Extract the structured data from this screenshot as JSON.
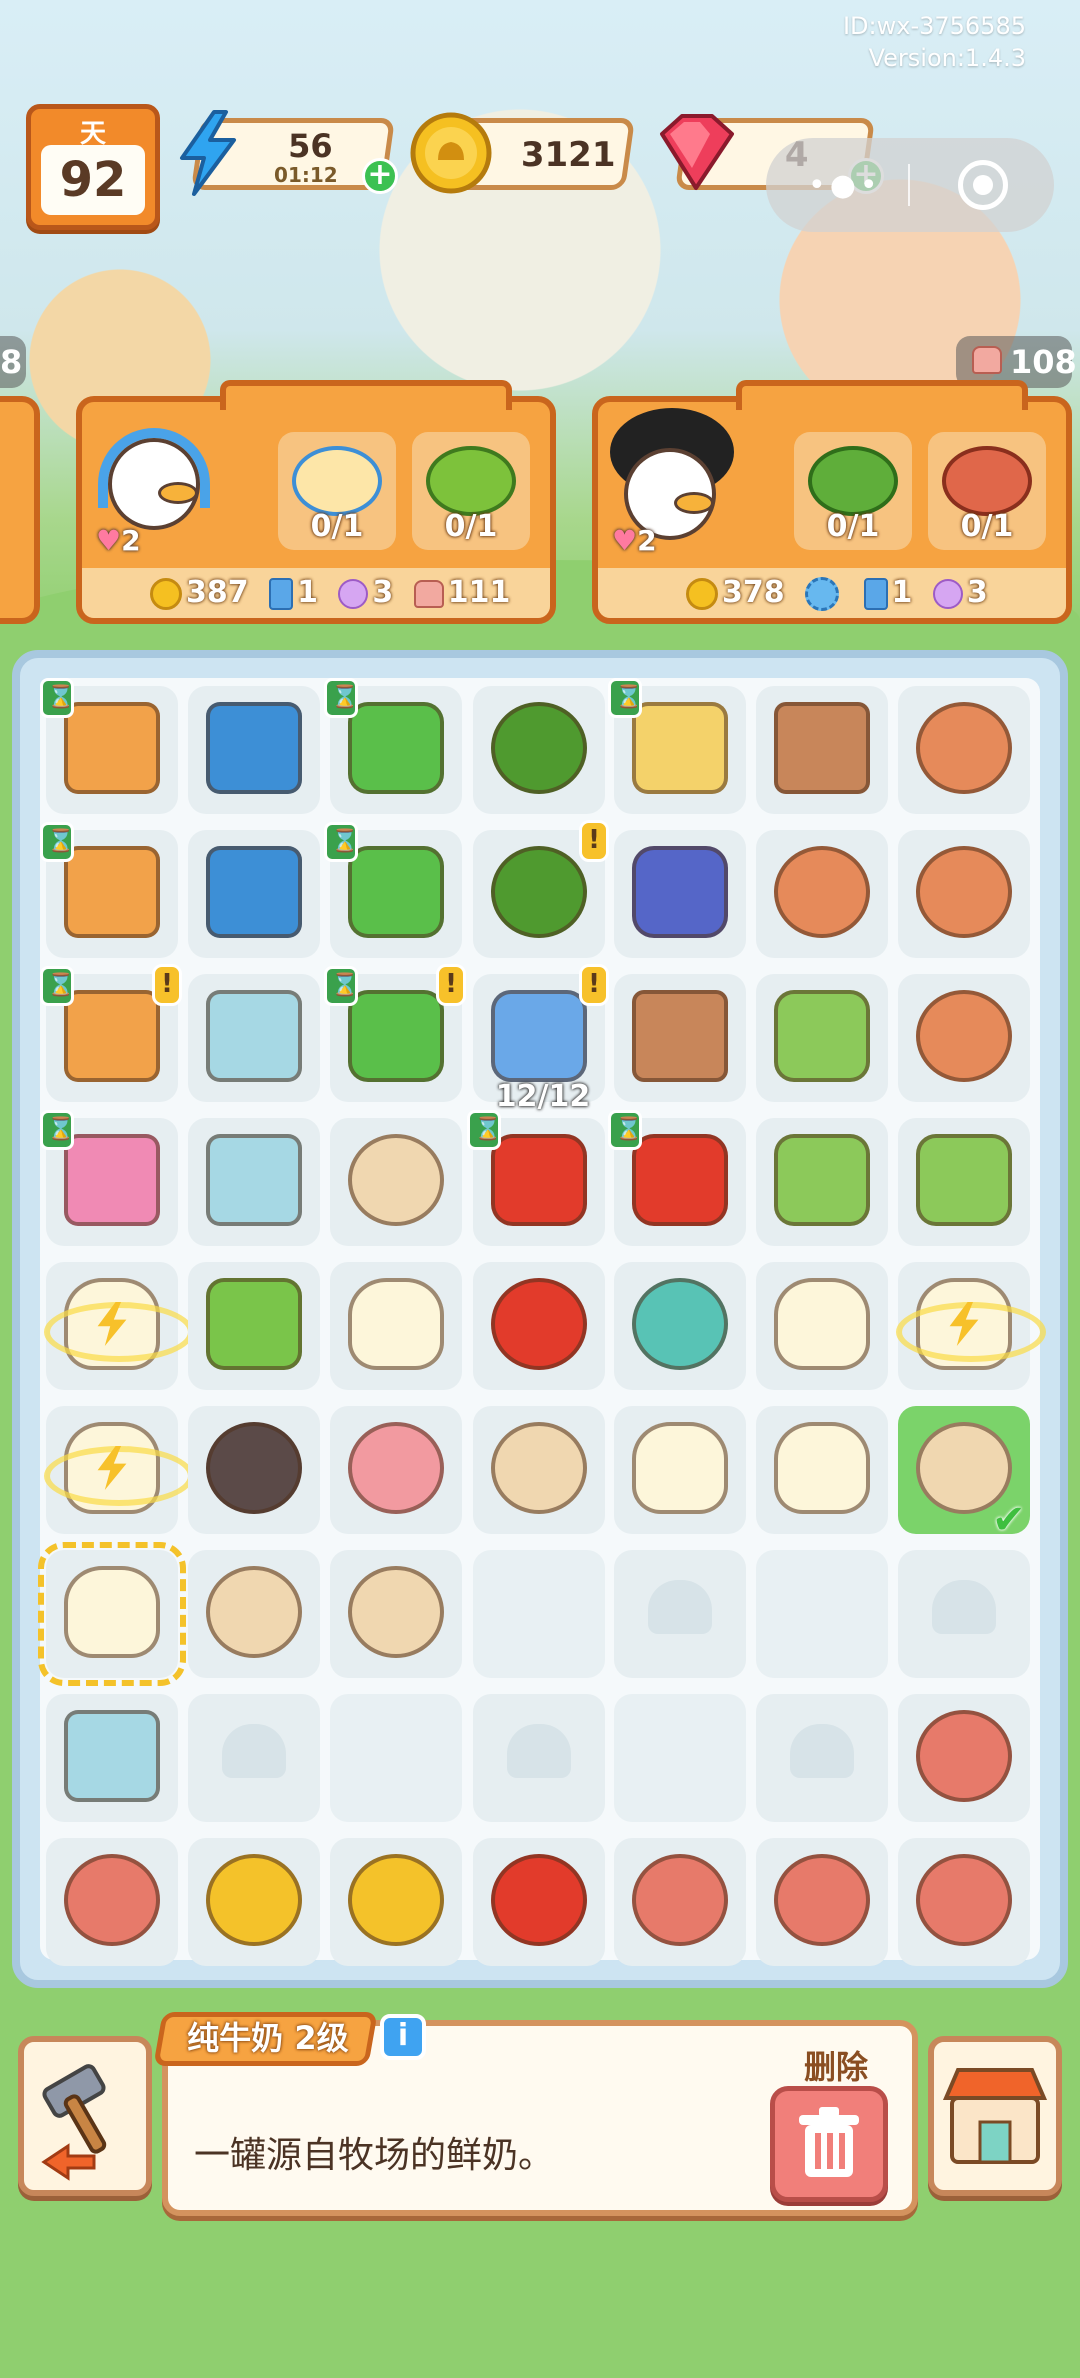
{
  "meta": {
    "id": "ID:wx-3756585",
    "version": "Version:1.4.3"
  },
  "hud": {
    "day_label": "天",
    "day_value": "92",
    "energy": {
      "value": "56",
      "timer": "01:12"
    },
    "coins": {
      "value": "3121"
    },
    "gems": {
      "value": "4"
    }
  },
  "side_badges": {
    "left": "8",
    "right": "108"
  },
  "orders": [
    {
      "customer": "duck-headphones",
      "hearts": "2",
      "items": [
        {
          "name": "porridge",
          "count": "0/1"
        },
        {
          "name": "broccoli",
          "count": "0/1"
        }
      ],
      "rewards": {
        "coins": "387",
        "cards": "1",
        "flowers": "3",
        "cakes": "111"
      }
    },
    {
      "customer": "duck-afro",
      "hearts": "2",
      "items": [
        {
          "name": "greens",
          "count": "0/1"
        },
        {
          "name": "braised-fish",
          "count": "0/1"
        }
      ],
      "rewards": {
        "coins": "378",
        "cards": "1",
        "flowers": "3"
      }
    }
  ],
  "board": {
    "fridge_capacity": "12/12",
    "cells": [
      [
        "cutting-station",
        "blue-oven",
        "green-stove",
        "fruit-bowl",
        "juicer",
        "spice-rack",
        "fishing-basket"
      ],
      [
        "knife-station",
        "blue-oven-2",
        "green-stove-2",
        "fruit-bowl-2",
        "bbq-grill",
        "veggie-basket",
        "fishing-rod"
      ],
      [
        "cheese-board",
        "ice-box",
        "green-stove-3",
        "fridge",
        "veggie-crate",
        "herb-box",
        "fish-lure"
      ],
      [
        "microwave",
        "glass-box",
        "teacup",
        "pot",
        "grill-pan",
        "leeks",
        "spice-jar"
      ],
      [
        "milk-bottle-glow",
        "soda-can",
        "milk-bottle",
        "tomato",
        "crab",
        "milk-bottle",
        "milk-bottle-glow"
      ],
      [
        "milk-bottle-glow",
        "eel",
        "squid",
        "coffee-cup",
        "milk-bottle",
        "milk-bottle",
        "red-tea-cup"
      ],
      [
        "milk-bottle-selected",
        "coffee-to-go",
        "espresso",
        "empty",
        "locked",
        "empty",
        "locked"
      ],
      [
        "ice-cube",
        "locked",
        "empty",
        "locked",
        "empty",
        "locked",
        "peanuts"
      ],
      [
        "meat-box",
        "orange-pudding",
        "lemon",
        "apple",
        "ham",
        "pork-slices",
        "meatballs"
      ]
    ]
  },
  "info_panel": {
    "title": "纯牛奶 2级",
    "description": "一罐源自牧场的鲜奶。",
    "delete_label": "删除"
  },
  "colors": {
    "accent_orange": "#f6a341",
    "board_bg": "#cde4f2",
    "grass": "#8fcf6f"
  }
}
